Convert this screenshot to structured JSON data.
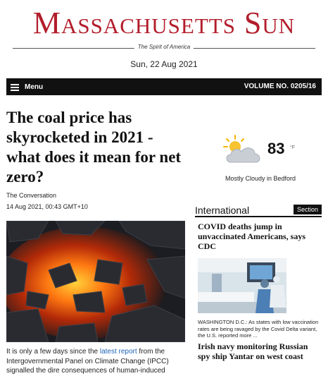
{
  "masthead": {
    "title": "Massachusetts Sun",
    "tagline": "The Spirit of America",
    "date": "Sun, 22 Aug 2021",
    "brand_color": "#b21d2b"
  },
  "menubar": {
    "menu_label": "Menu",
    "volume": "VOLUME NO. 0205/16"
  },
  "article": {
    "headline": "The coal price has skyrocketed in 2021 - what does it mean for net zero?",
    "source": "The Conversation",
    "published": "14 Aug 2021, 00:43 GMT+10",
    "body_before_link": "It is only a few days since the ",
    "body_link": "latest report",
    "body_after_link": " from the Intergovernmental Panel on Climate Change (IPCC) signalled the dire consequences of human-induced"
  },
  "weather": {
    "temperature": "83",
    "unit": "°F",
    "description": "Mostly Cloudy in Bedford",
    "icon": "partly-cloudy-icon"
  },
  "sidebar": {
    "title": "International",
    "badge": "Section",
    "stories": [
      {
        "title": "COVID deaths jump in unvaccinated Americans, says CDC",
        "summary": "WASHINGTON D.C.: As states with low vaccination rates are being ravaged by the Covid Delta variant, the U.S. reported more ..."
      },
      {
        "title": "Irish navy monitoring Russian spy ship Yantar on west coast"
      }
    ]
  }
}
